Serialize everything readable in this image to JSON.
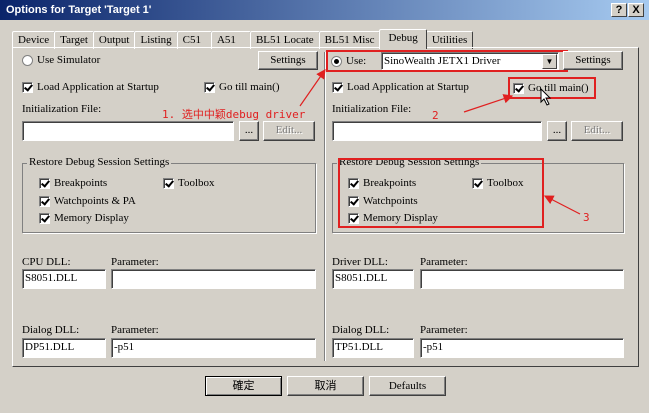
{
  "window": {
    "title": "Options for Target 'Target 1'",
    "help_label": "?",
    "close_label": "X"
  },
  "tabs": [
    {
      "label": "Device"
    },
    {
      "label": "Target"
    },
    {
      "label": "Output"
    },
    {
      "label": "Listing"
    },
    {
      "label": "C51"
    },
    {
      "label": "A51"
    },
    {
      "label": "BL51 Locate"
    },
    {
      "label": "BL51 Misc"
    },
    {
      "label": "Debug",
      "active": true
    },
    {
      "label": "Utilities"
    }
  ],
  "left": {
    "use_simulator_label": "Use Simulator",
    "settings_label": "Settings",
    "load_app_label": "Load Application at Startup",
    "go_till_main_label": "Go  till main()",
    "init_file_label": "Initialization File:",
    "init_file_value": "",
    "browse_label": "...",
    "edit_label": "Edit...",
    "restore_group_title": "Restore Debug Session Settings",
    "breakpoints_label": "Breakpoints",
    "toolbox_label": "Toolbox",
    "watchpoints_label": "Watchpoints & PA",
    "memory_display_label": "Memory Display",
    "cpu_dll_label": "CPU DLL:",
    "cpu_dll_value": "S8051.DLL",
    "cpu_param_label": "Parameter:",
    "cpu_param_value": "",
    "dialog_dll_label": "Dialog DLL:",
    "dialog_dll_value": "DP51.DLL",
    "dialog_param_label": "Parameter:",
    "dialog_param_value": "-p51"
  },
  "right": {
    "use_label": "Use:",
    "driver_value": "SinoWealth JETX1 Driver",
    "settings_label": "Settings",
    "load_app_label": "Load Application at Startup",
    "go_till_main_label": "Go  till main()",
    "init_file_label": "Initialization File:",
    "init_file_value": "",
    "browse_label": "...",
    "edit_label": "Edit...",
    "restore_group_title": "Restore Debug Session Settings",
    "breakpoints_label": "Breakpoints",
    "toolbox_label": "Toolbox",
    "watchpoints_label": "Watchpoints",
    "memory_display_label": "Memory Display",
    "driver_dll_label": "Driver DLL:",
    "driver_dll_value": "S8051.DLL",
    "driver_param_label": "Parameter:",
    "driver_param_value": "",
    "dialog_dll_label": "Dialog DLL:",
    "dialog_dll_value": "TP51.DLL",
    "dialog_param_label": "Parameter:",
    "dialog_param_value": "-p51"
  },
  "annotations": {
    "note1": "1. 选中中颖debug driver",
    "note2": "2",
    "note3": "3",
    "color": "#e02020"
  },
  "footer": {
    "ok_label": "確定",
    "cancel_label": "取消",
    "defaults_label": "Defaults"
  }
}
